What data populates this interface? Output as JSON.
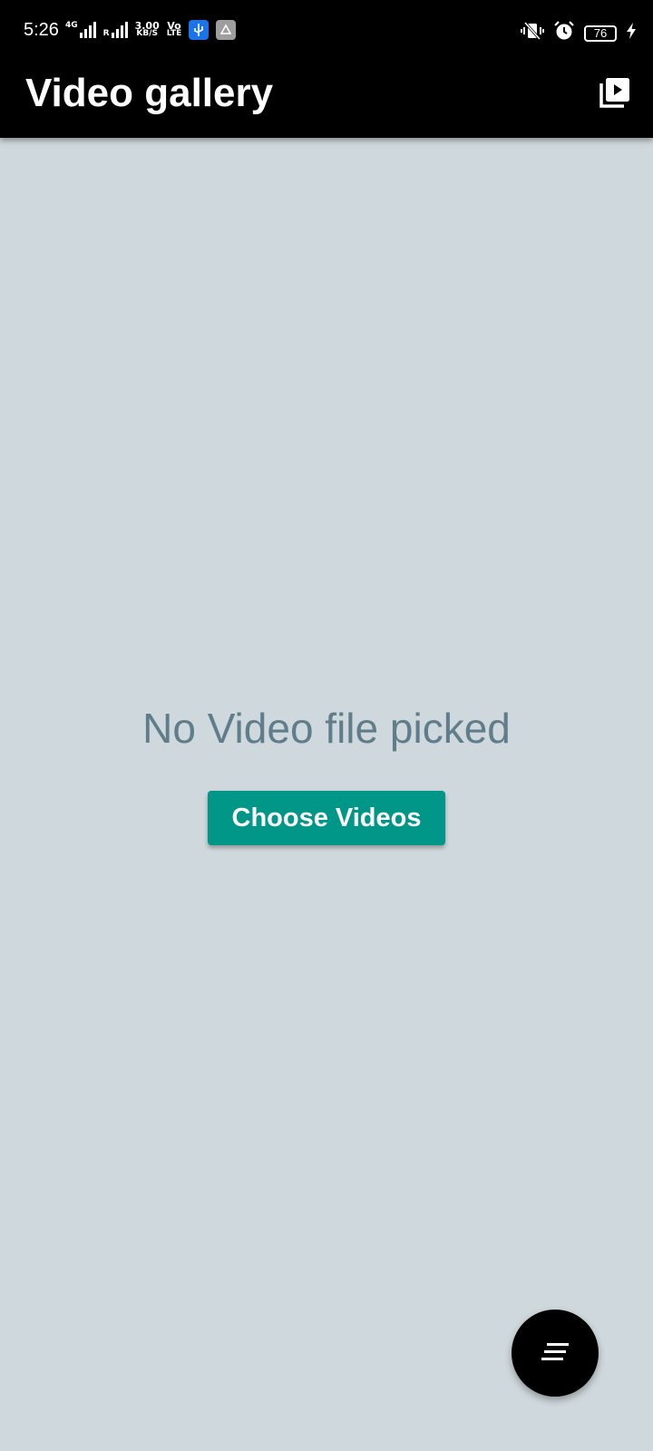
{
  "status_bar": {
    "time": "5:26",
    "network_4g": "4G",
    "network_r": "R",
    "speed_value": "3.00",
    "speed_unit": "KB/S",
    "volte_top": "Vo",
    "volte_bottom": "LTE",
    "battery": "76",
    "icons": [
      "signal-icon",
      "usb-icon",
      "drive-icon",
      "vibrate-icon",
      "alarm-icon",
      "battery-icon",
      "charging-icon"
    ]
  },
  "app_bar": {
    "title": "Video gallery",
    "action_icon": "video-library-icon"
  },
  "main": {
    "empty_message": "No Video file picked",
    "choose_button": "Choose Videos"
  },
  "fab": {
    "icon": "notes-icon"
  },
  "colors": {
    "background": "#cfd8dc",
    "app_bar": "#000000",
    "accent": "#009688",
    "empty_text": "#607d8b"
  }
}
